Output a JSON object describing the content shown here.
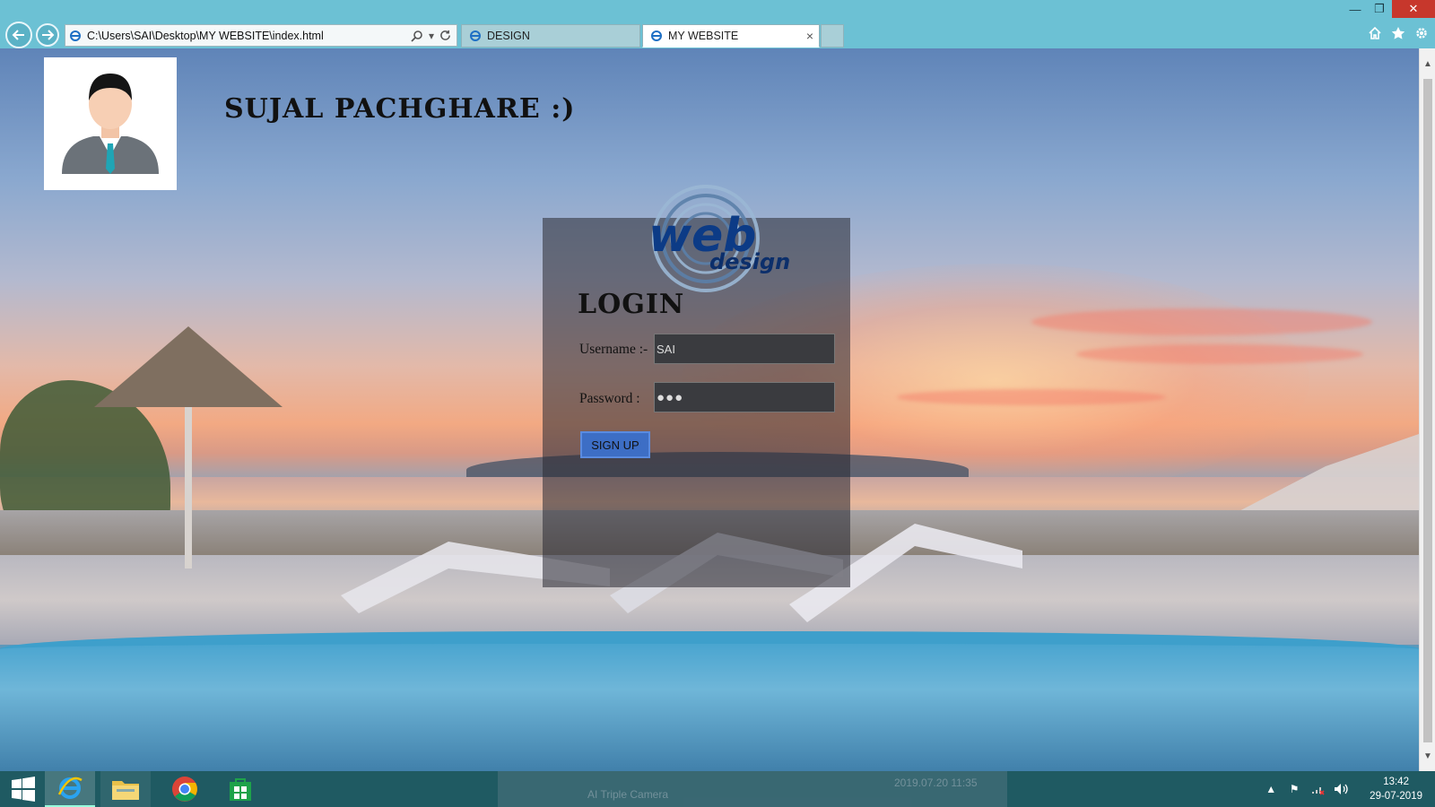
{
  "browser": {
    "address_url": "C:\\Users\\SAI\\Desktop\\MY WEBSITE\\index.html",
    "tabs": [
      {
        "label": "DESIGN",
        "active": false
      },
      {
        "label": "MY WEBSITE",
        "active": true
      }
    ],
    "close_tab_glyph": "×"
  },
  "page": {
    "site_title": "SUJAL PACHGHARE :)",
    "login_heading": "LOGIN",
    "username_label": "Username :-",
    "username_value": "SAI",
    "password_label": "Password :",
    "password_value": "●●●",
    "signup_label": "SIGN UP"
  },
  "taskbar": {
    "time": "13:42",
    "date": "29-07-2019",
    "ghost_caption": "AI Triple Camera",
    "ghost_timestamp": "2019.07.20 11:35"
  },
  "icons": [
    "back-icon",
    "forward-icon",
    "search-icon",
    "refresh-icon",
    "home-icon",
    "star-icon",
    "gear-icon",
    "windows-icon",
    "ie-icon",
    "folder-icon",
    "chrome-icon",
    "store-icon",
    "flag-icon",
    "network-icon",
    "volume-icon"
  ],
  "colors": {
    "chrome": "#6cc1d4",
    "taskbar": "#1f5a62",
    "signup_button": "#3d6ec5",
    "close_button": "#c7372c"
  }
}
